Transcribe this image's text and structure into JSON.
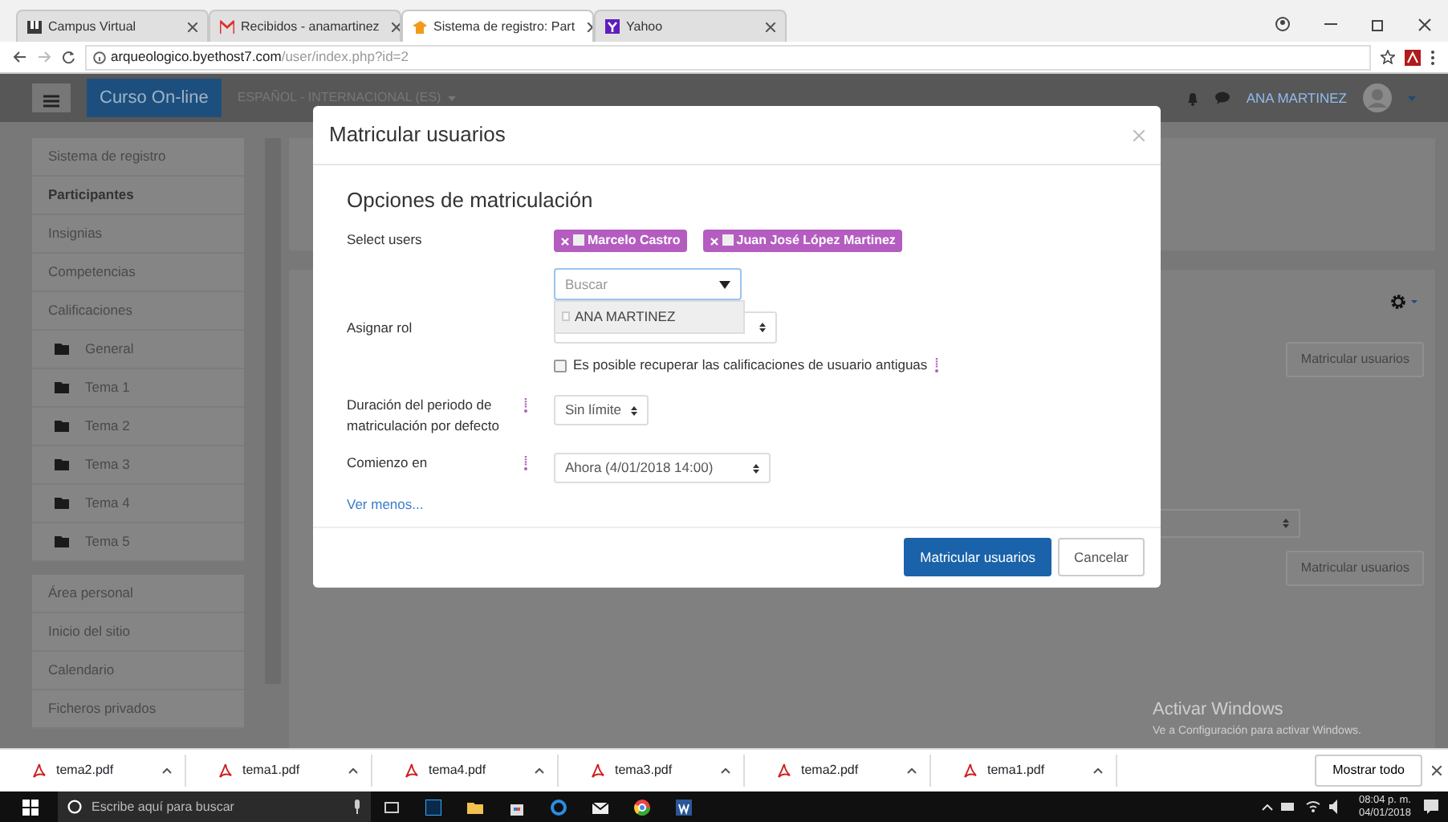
{
  "browser": {
    "tabs": [
      {
        "title": "Campus Virtual",
        "selected": false,
        "kind": "u"
      },
      {
        "title": "Recibidos - anamartinez",
        "selected": false,
        "kind": "mail"
      },
      {
        "title": "Sistema de registro: Part",
        "selected": true,
        "kind": "moodle"
      },
      {
        "title": "Yahoo",
        "selected": false,
        "kind": "y"
      }
    ],
    "url_host": "arqueologico.byethost7.com",
    "url_path": "/user/index.php?id=2"
  },
  "navbar": {
    "brand": "Curso On-line",
    "language": "ESPAÑOL - INTERNACIONAL (ES)",
    "user": "ANA MARTINEZ"
  },
  "sidebar": {
    "groups": [
      {
        "items": [
          {
            "label": "Sistema de registro",
            "selected": false,
            "kind": "link"
          },
          {
            "label": "Participantes",
            "selected": true,
            "kind": "link"
          },
          {
            "label": "Insignias",
            "selected": false,
            "kind": "link"
          },
          {
            "label": "Competencias",
            "selected": false,
            "kind": "link"
          },
          {
            "label": "Calificaciones",
            "selected": false,
            "kind": "link"
          },
          {
            "label": "General",
            "selected": false,
            "kind": "folder"
          },
          {
            "label": "Tema 1",
            "selected": false,
            "kind": "folder"
          },
          {
            "label": "Tema 2",
            "selected": false,
            "kind": "folder"
          },
          {
            "label": "Tema 3",
            "selected": false,
            "kind": "folder"
          },
          {
            "label": "Tema 4",
            "selected": false,
            "kind": "folder"
          },
          {
            "label": "Tema 5",
            "selected": false,
            "kind": "folder"
          }
        ]
      },
      {
        "items": [
          {
            "label": "Área personal",
            "selected": false,
            "kind": "link"
          },
          {
            "label": "Inicio del sitio",
            "selected": false,
            "kind": "link"
          },
          {
            "label": "Calendario",
            "selected": false,
            "kind": "link"
          },
          {
            "label": "Ficheros privados",
            "selected": false,
            "kind": "link"
          }
        ]
      }
    ]
  },
  "background": {
    "buttons": [
      "Matricular usuarios",
      "Matricular usuarios"
    ]
  },
  "modal": {
    "title": "Matricular usuarios",
    "section": "Opciones de matriculación",
    "select_users": {
      "label": "Select users",
      "chips": [
        "Marcelo Castro",
        "Juan José López Martinez"
      ],
      "placeholder": "Buscar",
      "suggestions": [
        "ANA MARTINEZ"
      ]
    },
    "role": {
      "label": "Asignar rol"
    },
    "recover": {
      "label": "Es posible recuperar las calificaciones de usuario antiguas",
      "checked": false
    },
    "duration": {
      "label": "Duración del periodo de matriculación por defecto",
      "value": "Sin límite"
    },
    "start": {
      "label": "Comienzo en",
      "value": "Ahora (4/01/2018 14:00)"
    },
    "toggle_link": "Ver menos...",
    "buttons": [
      {
        "label": "Matricular usuarios",
        "kind": "primary"
      },
      {
        "label": "Cancelar",
        "kind": "secondary"
      }
    ]
  },
  "os_notice": [
    "Activar Windows",
    "Ve a Configuración para activar Windows."
  ],
  "downloads": {
    "files": [
      "tema2.pdf",
      "tema1.pdf",
      "tema4.pdf",
      "tema3.pdf",
      "tema2.pdf",
      "tema1.pdf"
    ],
    "show_all": "Mostrar todo"
  },
  "taskbar": {
    "search_placeholder": "Escribe aquí para buscar",
    "time": "08:04 p. m.",
    "date": "04/01/2018"
  }
}
